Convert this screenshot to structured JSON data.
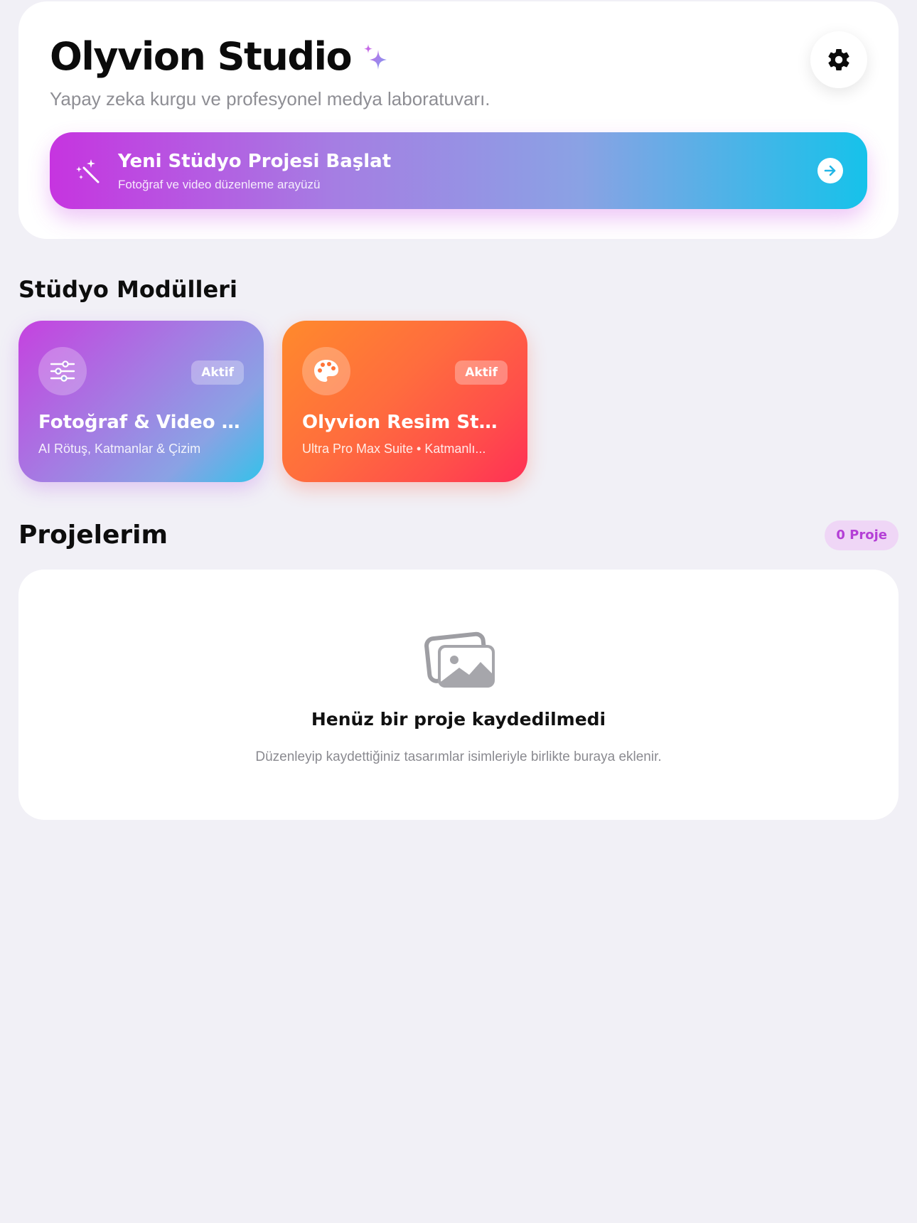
{
  "header": {
    "title": "Olyvion Studio",
    "subtitle": "Yapay zeka kurgu ve profesyonel medya laboratuvarı.",
    "settings_icon": "gear-icon",
    "sparkle_icon": "sparkle-icon"
  },
  "cta": {
    "title": "Yeni Stüdyo Projesi Başlat",
    "subtitle": "Fotoğraf ve video düzenleme arayüzü",
    "icon": "magic-wand-icon",
    "arrow_icon": "arrow-right-circle-icon"
  },
  "modules": {
    "heading": "Stüdyo Modülleri",
    "items": [
      {
        "title": "Fotoğraf & Video S...",
        "subtitle": "AI Rötuş, Katmanlar & Çizim",
        "badge": "Aktif",
        "icon": "sliders-icon"
      },
      {
        "title": "Olyvion Resim Stü...",
        "subtitle": "Ultra Pro Max Suite • Katmanlı...",
        "badge": "Aktif",
        "icon": "palette-icon"
      }
    ]
  },
  "projects": {
    "heading": "Projelerim",
    "count_label": "0 Proje",
    "empty_icon": "photos-icon",
    "empty_title": "Henüz bir proje kaydedilmedi",
    "empty_subtitle": "Düzenleyip kaydettiğiniz tasarımlar isimleriyle birlikte buraya eklenir."
  },
  "colors": {
    "background": "#f1f0f6",
    "accent_purple": "#c634e0",
    "accent_cyan": "#16c2ea",
    "accent_orange": "#ff8a2c",
    "accent_red": "#ff3055",
    "pill_text": "#b43fd6"
  }
}
